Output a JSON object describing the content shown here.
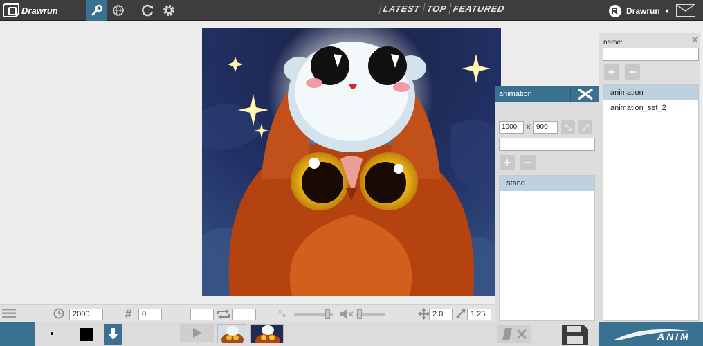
{
  "app": {
    "name": "Drawrun"
  },
  "nav": {
    "items": [
      "LATEST",
      "TOP",
      "FEATURED"
    ]
  },
  "user": {
    "name": "Drawrun"
  },
  "names_panel": {
    "label": "name:",
    "value": "",
    "items": [
      {
        "label": "animation",
        "selected": true
      },
      {
        "label": "animation_set_2",
        "selected": false
      }
    ]
  },
  "anim_panel": {
    "title": "animation",
    "width": "1000",
    "sep": "X",
    "height": "900",
    "name_value": "",
    "items": [
      {
        "label": "stand",
        "selected": true
      }
    ]
  },
  "toolbar": {
    "duration": "2000",
    "hash_symbol": "#",
    "frame_index": "0",
    "loop_from": "",
    "loop_to": "",
    "scale": "2.0",
    "size_ratio": "1.25"
  },
  "footer": {
    "logo_text": "ANIM"
  },
  "colors": {
    "accent": "#3a7191",
    "topbar": "#3d3d3d",
    "panel": "#dedede",
    "selected_row": "#bdd1de"
  },
  "icons": [
    "wrench-icon",
    "globe-icon",
    "refresh-icon",
    "gear-icon",
    "mail-icon",
    "menu-icon",
    "clock-icon",
    "loop-icon",
    "shrink-icon",
    "volume-icon",
    "move-icon",
    "resize-icon",
    "play-icon",
    "eraser-icon",
    "close-icon",
    "save-icon",
    "download-icon"
  ]
}
